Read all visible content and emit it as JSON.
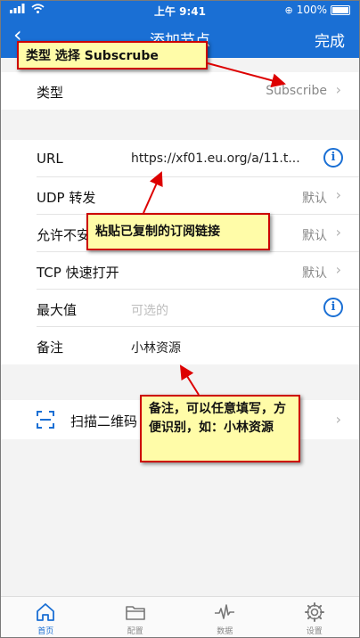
{
  "status_bar": {
    "time": "上午 9:41",
    "battery": "100%"
  },
  "nav": {
    "title": "添加节点",
    "done_label": "完成"
  },
  "form": {
    "type_label": "类型",
    "type_value": "Subscribe",
    "url_label": "URL",
    "url_value": "https://xf01.eu.org/a/11.t...",
    "udp_label": "UDP 转发",
    "udp_value": "默认",
    "insecure_label": "允许不安全",
    "insecure_value": "默认",
    "tcp_label": "TCP 快速打开",
    "tcp_value": "默认",
    "max_label": "最大值",
    "max_placeholder": "可选的",
    "note_label": "备注",
    "note_value": "小林资源",
    "scan_label": "扫描二维码"
  },
  "tabs": [
    {
      "label": "首页",
      "icon": "home-icon",
      "active": true
    },
    {
      "label": "配置",
      "icon": "folder-icon",
      "active": false
    },
    {
      "label": "数据",
      "icon": "pulse-icon",
      "active": false
    },
    {
      "label": "设置",
      "icon": "gear-icon",
      "active": false
    }
  ],
  "callouts": {
    "type_hint": "类型 选择 Subscrube",
    "paste_hint": "粘贴已复制的订阅链接",
    "note_hint": "备注，可以任意填写，方便识别，如：小林资源"
  },
  "colors": {
    "accent": "#1a6fd4",
    "callout_bg": "#fffca8",
    "callout_border": "#cc0000"
  }
}
